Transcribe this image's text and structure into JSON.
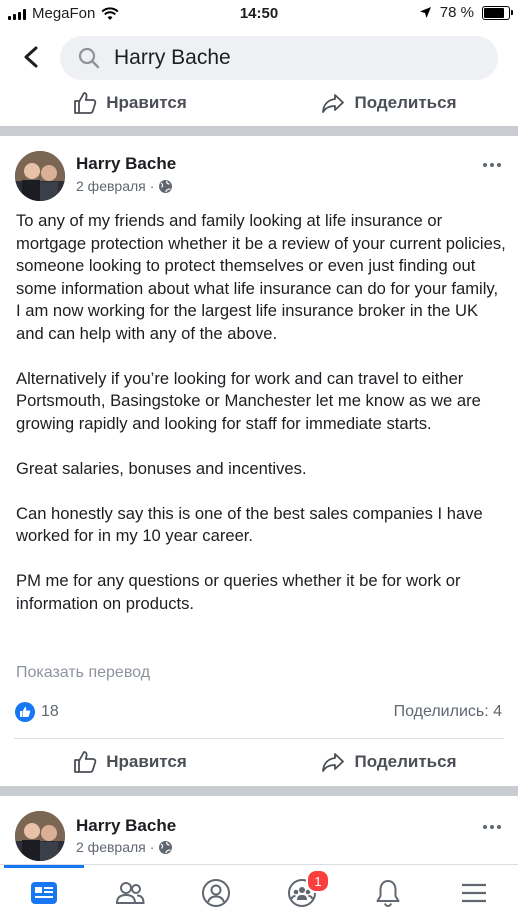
{
  "status": {
    "carrier": "MegaFon",
    "time": "14:50",
    "battery_percent": "78 %",
    "battery_level": 0.78
  },
  "search": {
    "query": "Harry Bache"
  },
  "actions": {
    "like_label": "Нравится",
    "share_label": "Поделиться"
  },
  "post": {
    "author": "Harry Bache",
    "date": "2 февраля",
    "date_sep": "·",
    "paragraphs": [
      "To any of my friends and family looking at life insurance or mortgage protection whether it be a review of your current policies, someone looking to protect themselves or even just finding out  some information about what life insurance can do for your family, I am now working for the largest life insurance broker in the UK and can help with any of the above.",
      "Alternatively if you’re looking for work and can travel to either Portsmouth, Basingstoke or Manchester let me know as we are growing rapidly and looking for staff for immediate starts.",
      "Great salaries, bonuses and incentives.",
      "Can honestly say this is one of the best sales companies I have worked for in my 10 year career.",
      "PM me for any questions or queries whether it be for work or information on products."
    ],
    "translate": "Показать перевод",
    "like_count": "18",
    "shares": "Поделились: 4"
  },
  "next_post": {
    "author": "Harry Bache",
    "date": "2 февраля",
    "date_sep": "·"
  },
  "tabbar": {
    "groups_badge": "1",
    "active_color": "#1877f2"
  }
}
